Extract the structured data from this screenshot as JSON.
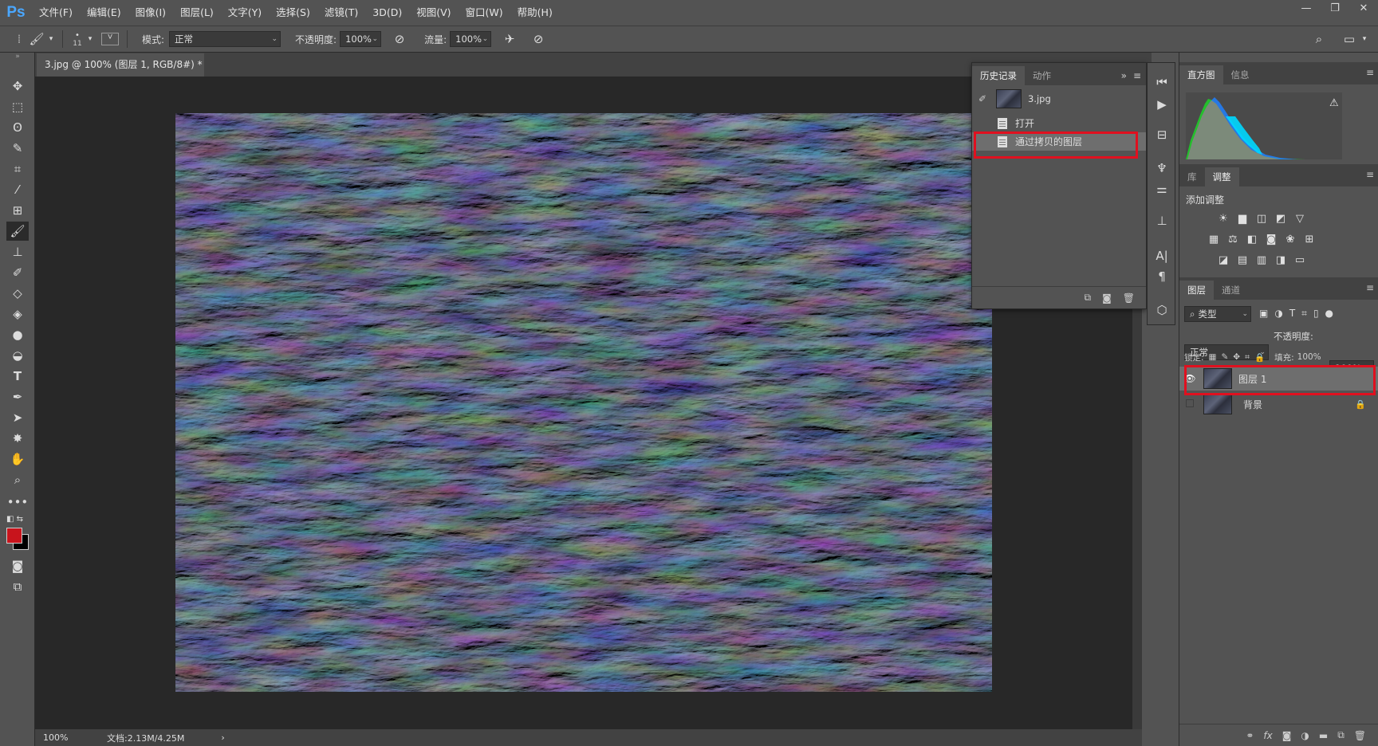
{
  "app": {
    "logo": "Ps"
  },
  "menu": [
    "文件(F)",
    "编辑(E)",
    "图像(I)",
    "图层(L)",
    "文字(Y)",
    "选择(S)",
    "滤镜(T)",
    "3D(D)",
    "视图(V)",
    "窗口(W)",
    "帮助(H)"
  ],
  "window_controls": {
    "minimize": "—",
    "restore": "❐",
    "close": "✕"
  },
  "options": {
    "brush_size": "11",
    "mode_label": "模式:",
    "mode_value": "正常",
    "opacity_label": "不透明度:",
    "opacity_value": "100%",
    "flow_label": "流量:",
    "flow_value": "100%"
  },
  "document": {
    "tab_title": "3.jpg @ 100% (图层 1, RGB/8#) *",
    "tab_close": "×",
    "zoom": "100%",
    "doc_info": "文档:2.13M/4.25M",
    "status_arrow": "›"
  },
  "history": {
    "tabs": [
      "历史记录",
      "动作"
    ],
    "snapshot_label": "3.jpg",
    "items": [
      "打开",
      "通过拷贝的图层"
    ],
    "expand": "»",
    "menu": "≡"
  },
  "histogram": {
    "tabs": [
      "直方图",
      "信息"
    ],
    "warning": "⚠"
  },
  "adjustments": {
    "tabs": [
      "库",
      "调整"
    ],
    "title": "添加调整"
  },
  "layers": {
    "tabs": [
      "图层",
      "通道"
    ],
    "filter_label": "类型",
    "blend_mode": "正常",
    "opacity_label": "不透明度:",
    "opacity_value": "100%",
    "lock_label": "锁定:",
    "fill_label": "填充:",
    "fill_value": "100%",
    "items": [
      {
        "name": "图层 1",
        "visible": true,
        "locked": false
      },
      {
        "name": "背景",
        "visible": false,
        "locked": true
      }
    ],
    "footer_fx": "fx"
  },
  "colors": {
    "foreground": "#c8141c",
    "background": "#000000",
    "highlight": "#e0101f"
  }
}
